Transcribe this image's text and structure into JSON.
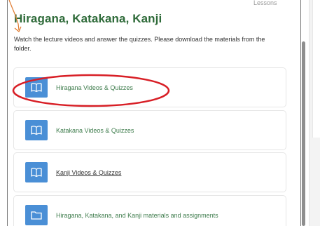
{
  "header": {
    "top_label": "Lessons",
    "title": "Hiragana, Katakana, Kanji",
    "description": "Watch the lecture videos and answer the quizzes. Please download the materials from the folder."
  },
  "items": [
    {
      "label": "Hiragana Videos & Quizzes",
      "icon": "book-icon"
    },
    {
      "label": "Katakana Videos & Quizzes",
      "icon": "book-icon"
    },
    {
      "label": "Kanji Videos & Quizzes",
      "icon": "book-icon"
    },
    {
      "label": "Hiragana, Katakana, and Kanji materials and assignments",
      "icon": "folder-icon"
    }
  ],
  "colors": {
    "title_green": "#2f6b3a",
    "icon_blue": "#4a8fd6",
    "annotation_red": "#d81f26",
    "annotation_orange": "#e07a2e"
  }
}
